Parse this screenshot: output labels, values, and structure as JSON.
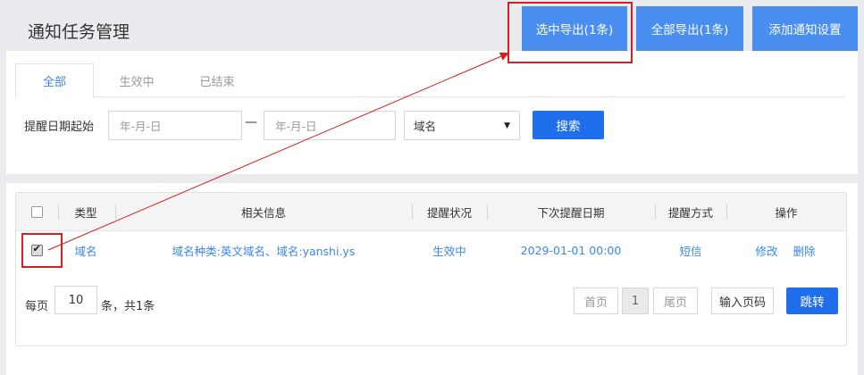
{
  "header": {
    "title": "通知任务管理",
    "export_selected_label": "选中导出(1条)",
    "export_all_label": "全部导出(1条)",
    "add_setting_label": "添加通知设置"
  },
  "tabs": [
    {
      "label": "全部",
      "active": true
    },
    {
      "label": "生效中",
      "active": false
    },
    {
      "label": "已结束",
      "active": false
    }
  ],
  "filter": {
    "date_label": "提醒日期起始",
    "start_placeholder": "年-月-日",
    "range_separator": "—",
    "end_placeholder": "年-月-日",
    "type_selected": "域名",
    "search_label": "搜索"
  },
  "table": {
    "columns": [
      "类型",
      "相关信息",
      "提醒状况",
      "下次提醒日期",
      "提醒方式",
      "操作"
    ],
    "rows": [
      {
        "checked": true,
        "type": "域名",
        "info": "域名种类:英文域名、域名:yanshi.ys",
        "status": "生效中",
        "next_date": "2029-01-01 00:00",
        "method": "短信",
        "edit": "修改",
        "delete": "删除"
      }
    ]
  },
  "pager": {
    "per_page_label": "每页",
    "per_page_value": "10",
    "total_label": "条，共1条",
    "first_label": "首页",
    "current_page": "1",
    "last_label": "尾页",
    "goto_placeholder": "输入页码",
    "jump_label": "跳转"
  },
  "colors": {
    "primary": "#1f6fec",
    "header_button": "#4a8ff0",
    "link": "#3a87f0",
    "annotation": "#d81e1e"
  }
}
